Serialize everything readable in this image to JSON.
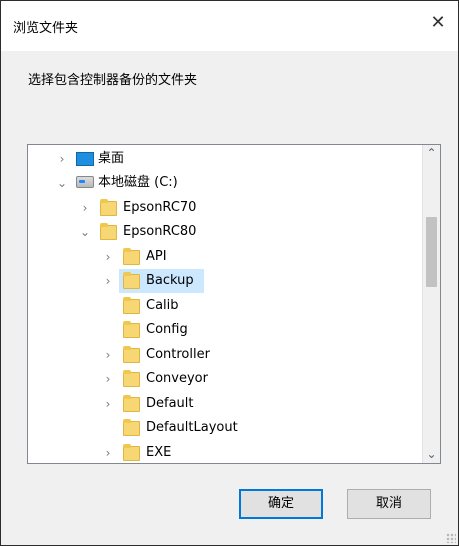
{
  "window": {
    "title": "浏览文件夹",
    "close_glyph": "✕"
  },
  "instruction": "选择包含控制器备份的文件夹",
  "tree": {
    "items": [
      {
        "label": "桌面",
        "icon": "desktop-icon",
        "expander": "collapsed"
      },
      {
        "label": "本地磁盘 (C:)",
        "icon": "drive-icon",
        "expander": "expanded"
      },
      {
        "label": "EpsonRC70",
        "icon": "folder-icon",
        "expander": "collapsed"
      },
      {
        "label": "EpsonRC80",
        "icon": "folder-icon",
        "expander": "expanded"
      },
      {
        "label": "API",
        "icon": "folder-icon",
        "expander": "collapsed"
      },
      {
        "label": "Backup",
        "icon": "folder-icon",
        "expander": "collapsed",
        "selected": true
      },
      {
        "label": "Calib",
        "icon": "folder-icon",
        "expander": "none"
      },
      {
        "label": "Config",
        "icon": "folder-icon",
        "expander": "none"
      },
      {
        "label": "Controller",
        "icon": "folder-icon",
        "expander": "collapsed"
      },
      {
        "label": "Conveyor",
        "icon": "folder-icon",
        "expander": "collapsed"
      },
      {
        "label": "Default",
        "icon": "folder-icon",
        "expander": "collapsed"
      },
      {
        "label": "DefaultLayout",
        "icon": "folder-icon",
        "expander": "none"
      },
      {
        "label": "EXE",
        "icon": "folder-icon",
        "expander": "collapsed"
      }
    ]
  },
  "buttons": {
    "ok": "确定",
    "cancel": "取消"
  },
  "colors": {
    "selection": "#cce8ff",
    "primary_border": "#0078d7"
  }
}
